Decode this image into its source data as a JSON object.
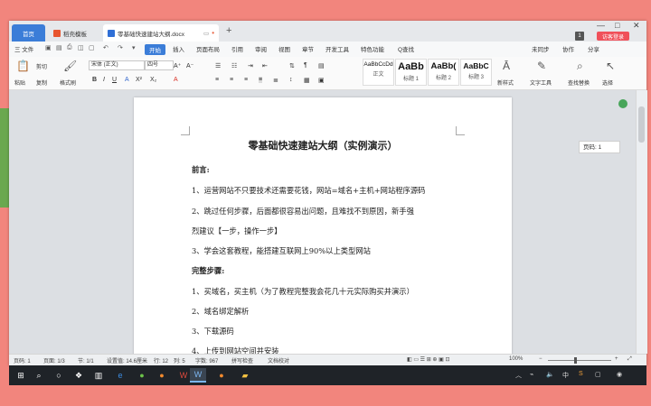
{
  "tabs": {
    "home": "首页",
    "templates": "稻壳模板",
    "document": "零基础快速建站大纲.docx"
  },
  "window": {
    "page_badge": "1",
    "login_button": "访客登录",
    "minimize": "—",
    "restore": "□",
    "close": "✕"
  },
  "menu": {
    "file": "三 文件",
    "items": [
      "开始",
      "插入",
      "页面布局",
      "引用",
      "审阅",
      "视图",
      "章节",
      "开发工具",
      "特色功能",
      "Q查找"
    ],
    "right": [
      "未同步",
      "协作",
      "分享"
    ]
  },
  "ribbon": {
    "paste": "粘贴",
    "cut": "剪切",
    "copy": "复制",
    "format_painter": "格式刷",
    "font_name": "宋体 (正文)",
    "font_size": "四号",
    "styles": [
      {
        "sample": "AaBbCcDd",
        "label": "正文"
      },
      {
        "sample": "AaBb",
        "label": "标题 1"
      },
      {
        "sample": "AaBb(",
        "label": "标题 2"
      },
      {
        "sample": "AaBbC",
        "label": "标题 3"
      }
    ],
    "new_style": "新样式",
    "text_tools": "文字工具",
    "find_replace": "查找替换",
    "select": "选择"
  },
  "document": {
    "title": "零基础快速建站大纲（实例演示）",
    "paragraphs": [
      "前言:",
      "1、运营网站不只要技术还需要花钱，网站=域名+主机+网站程序源码",
      "2、跳过任何步骤，后面都很容易出问题，且难找不到原因，新手强",
      "烈建议【一步，操作一步】",
      "3、学会这套教程，能搭建互联网上90%以上类型网站",
      "完整步骤:",
      "1、买域名，买主机（为了教程完整我会花几十元实际购买并演示）",
      "2、域名绑定解析",
      "3、下载源码",
      "4、上传到网站空间并安装"
    ]
  },
  "page_tip": "页码: 1",
  "status": {
    "page": "页码: 1",
    "pages": "页面: 1/3",
    "section": "节: 1/1",
    "position": "设置值: 14.6厘米",
    "row": "行: 12",
    "col": "列: 5",
    "words": "字数: 967",
    "spellcheck": "拼写检查",
    "doc_proof": "文档校对",
    "zoom": "100%"
  },
  "taskbar": {
    "tray_text": "中",
    "ime": "S"
  }
}
